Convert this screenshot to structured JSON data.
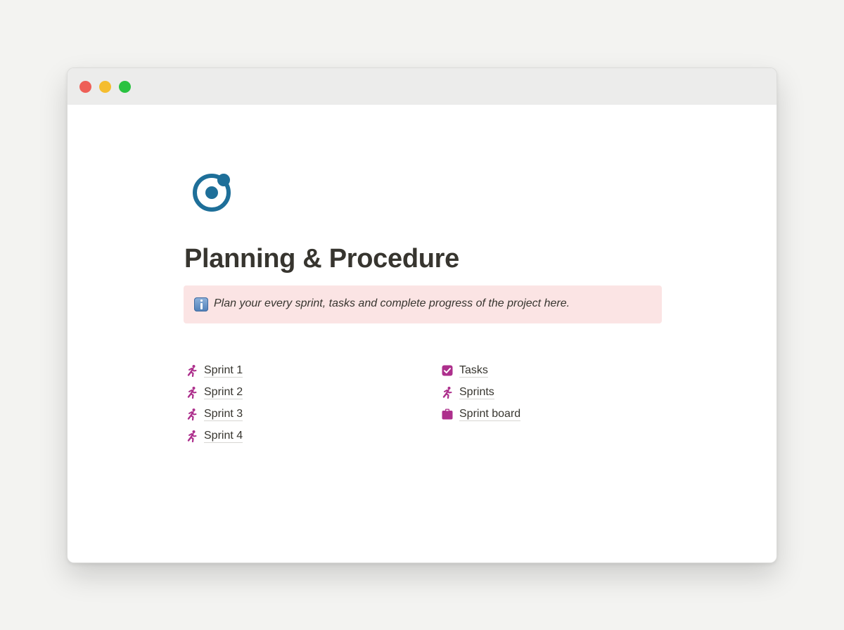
{
  "page": {
    "title": "Planning & Procedure",
    "icon": "ring-target-icon"
  },
  "callout": {
    "icon": "info-icon",
    "text": "Plan your every sprint, tasks and complete progress of the project here."
  },
  "links_left": [
    {
      "label": "Sprint 1",
      "icon": "running-person-icon"
    },
    {
      "label": "Sprint 2",
      "icon": "running-person-icon"
    },
    {
      "label": "Sprint 3",
      "icon": "running-person-icon"
    },
    {
      "label": "Sprint 4",
      "icon": "running-person-icon"
    }
  ],
  "links_right": [
    {
      "label": "Tasks",
      "icon": "checkbox-icon"
    },
    {
      "label": "Sprints",
      "icon": "running-person-icon"
    },
    {
      "label": "Sprint board",
      "icon": "clipboard-icon"
    }
  ],
  "colors": {
    "close": "#ee5f57",
    "minimize": "#f5bd2f",
    "maximize": "#29c240",
    "page_icon": "#1e6f99",
    "link_icon": "#ad2f8c",
    "callout_bg": "#fbe4e4"
  }
}
